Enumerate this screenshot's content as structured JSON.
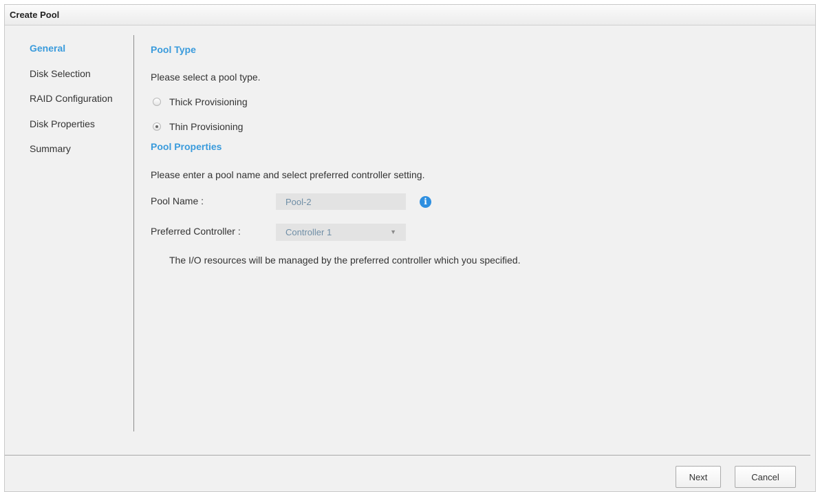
{
  "dialog": {
    "title": "Create Pool"
  },
  "nav": {
    "items": [
      {
        "label": "General",
        "active": true
      },
      {
        "label": "Disk Selection",
        "active": false
      },
      {
        "label": "RAID Configuration",
        "active": false
      },
      {
        "label": "Disk Properties",
        "active": false
      },
      {
        "label": "Summary",
        "active": false
      }
    ]
  },
  "pool_type": {
    "heading": "Pool Type",
    "prompt": "Please select a pool type.",
    "options": [
      {
        "label": "Thick Provisioning",
        "selected": false
      },
      {
        "label": "Thin Provisioning",
        "selected": true
      }
    ]
  },
  "pool_properties": {
    "heading": "Pool Properties",
    "prompt": "Please enter a pool name and select preferred controller setting.",
    "pool_name_label": "Pool Name :",
    "pool_name_value": "Pool-2",
    "info_icon": "info-icon",
    "controller_label": "Preferred Controller :",
    "controller_value": "Controller 1",
    "note": "The I/O resources will be managed by the preferred controller which you specified."
  },
  "footer": {
    "next_label": "Next",
    "cancel_label": "Cancel"
  },
  "colors": {
    "accent": "#3a9bdc",
    "info_icon": "#2e8fe0",
    "dialog_bg": "#f1f1f1"
  }
}
